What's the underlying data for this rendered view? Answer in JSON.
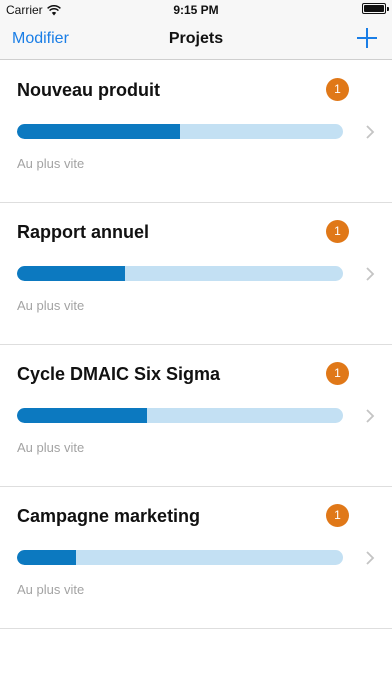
{
  "status_bar": {
    "carrier": "Carrier",
    "time": "9:15 PM"
  },
  "nav": {
    "edit_label": "Modifier",
    "title": "Projets",
    "add_icon": "plus-icon"
  },
  "colors": {
    "accent": "#1a7ee6",
    "badge": "#e07818",
    "progress_fill": "#0c79c0",
    "progress_track": "#c3e0f3"
  },
  "projects": [
    {
      "title": "Nouveau produit",
      "badge": "1",
      "progress_percent": 50,
      "subtitle": "Au plus vite"
    },
    {
      "title": "Rapport annuel",
      "badge": "1",
      "progress_percent": 33,
      "subtitle": "Au plus vite"
    },
    {
      "title": "Cycle DMAIC Six Sigma",
      "badge": "1",
      "progress_percent": 40,
      "subtitle": "Au plus vite"
    },
    {
      "title": "Campagne marketing",
      "badge": "1",
      "progress_percent": 18,
      "subtitle": "Au plus vite"
    }
  ]
}
